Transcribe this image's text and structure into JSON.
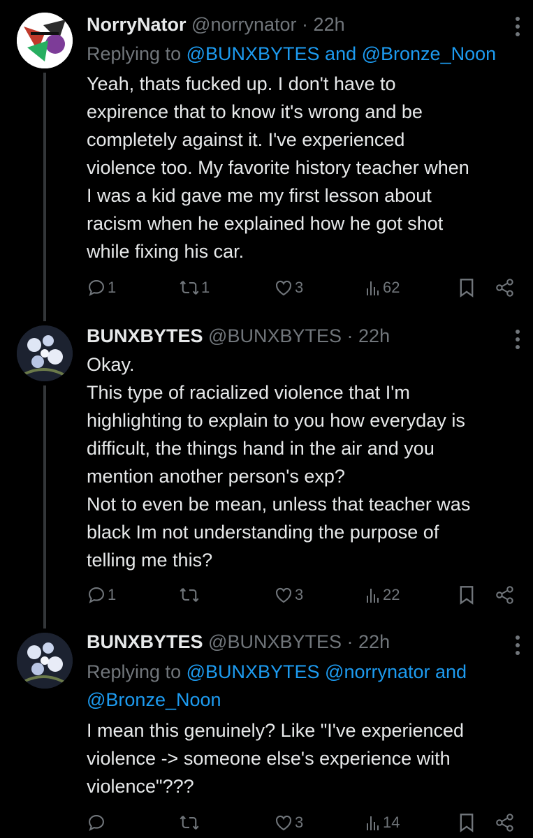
{
  "tweets": [
    {
      "name": "NorryNator",
      "handle": "@norrynator",
      "dot": "·",
      "time": "22h",
      "reply_prefix": "Replying to",
      "reply_mentions": "@BUNXBYTES and @Bronze_Noon",
      "body": "Yeah, thats fucked up. I don't have to\nexpirence that to know it's wrong and be\ncompletely against it. I've experienced\nviolence too. My favorite history teacher when\nI was a kid gave me my first lesson about\nracism when he explained how he got shot\nwhile fixing his car.",
      "replies": "1",
      "reposts": "1",
      "likes": "3",
      "views": "62"
    },
    {
      "name": "BUNXBYTES",
      "handle": "@BUNXBYTES",
      "dot": "·",
      "time": "22h",
      "body": "Okay.\nThis type of racialized violence that I'm\nhighlighting to explain to you how everyday is\ndifficult, the things hand in the air and you\nmention another person's exp?\nNot to even be mean, unless that teacher was\nblack Im not understanding the purpose of\ntelling me this?",
      "replies": "1",
      "reposts": "",
      "likes": "3",
      "views": "22"
    },
    {
      "name": "BUNXBYTES",
      "handle": "@BUNXBYTES",
      "dot": "·",
      "time": "22h",
      "reply_prefix": "Replying to",
      "reply_mentions_line1": "@BUNXBYTES @norrynator and",
      "reply_mentions_line2": "@Bronze_Noon",
      "body": "I mean this genuinely? Like \"I've experienced\nviolence -> someone else's experience with\nviolence\"???",
      "replies": "",
      "reposts": "",
      "likes": "3",
      "views": "14"
    }
  ],
  "icons": {
    "reply": "reply-icon",
    "repost": "repost-icon",
    "like": "heart-icon",
    "views": "views-icon",
    "bookmark": "bookmark-icon",
    "share": "share-icon",
    "more": "more-icon"
  },
  "colors": {
    "background": "#000000",
    "text": "#e7e9ea",
    "muted": "#71767b",
    "link": "#1d9bf0"
  }
}
